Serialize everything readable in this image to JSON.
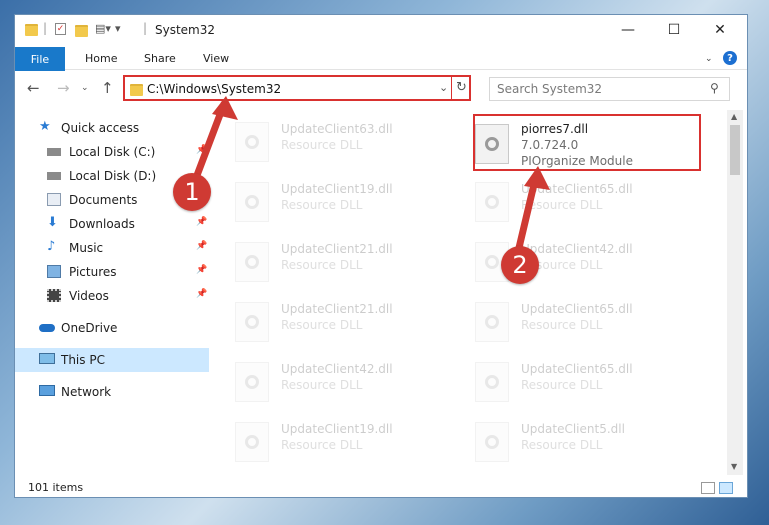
{
  "window": {
    "title": "System32",
    "controls": {
      "minimize": "—",
      "maximize": "☐",
      "close": "✕"
    }
  },
  "ribbon": {
    "file_tab": "File",
    "tabs": [
      "Home",
      "Share",
      "View"
    ],
    "help": "?"
  },
  "navigation": {
    "address": "C:\\Windows\\System32",
    "search_placeholder": "Search System32"
  },
  "sidebar": {
    "items": [
      {
        "label": "Quick access",
        "icon": "star-icon"
      },
      {
        "label": "Local Disk (C:)",
        "icon": "drive-icon",
        "pinned": true
      },
      {
        "label": "Local Disk (D:)",
        "icon": "drive-icon"
      },
      {
        "label": "Documents",
        "icon": "documents-icon",
        "pinned": true
      },
      {
        "label": "Downloads",
        "icon": "download-icon",
        "pinned": true
      },
      {
        "label": "Music",
        "icon": "music-icon",
        "pinned": true
      },
      {
        "label": "Pictures",
        "icon": "pictures-icon",
        "pinned": true
      },
      {
        "label": "Videos",
        "icon": "videos-icon",
        "pinned": true
      },
      {
        "label": "OneDrive",
        "icon": "cloud-icon"
      },
      {
        "label": "This PC",
        "icon": "computer-icon",
        "selected": true
      },
      {
        "label": "Network",
        "icon": "network-icon"
      }
    ]
  },
  "files": {
    "left_column": [
      {
        "name": "UpdateClient63.dll",
        "type": "Resource DLL"
      },
      {
        "name": "UpdateClient19.dll",
        "type": "Resource DLL"
      },
      {
        "name": "UpdateClient21.dll",
        "type": "Resource DLL"
      },
      {
        "name": "UpdateClient21.dll",
        "type": "Resource DLL"
      },
      {
        "name": "UpdateClient42.dll",
        "type": "Resource DLL"
      },
      {
        "name": "UpdateClient19.dll",
        "type": "Resource DLL"
      }
    ],
    "highlighted": {
      "name": "piorres7.dll",
      "version": "7.0.724.0",
      "description": "PIOrganize Module"
    },
    "right_column": [
      {
        "name": "UpdateClient65.dll",
        "type": "Resource DLL"
      },
      {
        "name": "UpdateClient42.dll",
        "type": "Resource DLL"
      },
      {
        "name": "UpdateClient65.dll",
        "type": "Resource DLL"
      },
      {
        "name": "UpdateClient65.dll",
        "type": "Resource DLL"
      },
      {
        "name": "UpdateClient5.dll",
        "type": "Resource DLL"
      }
    ]
  },
  "status": {
    "item_count": "101 items"
  },
  "callouts": {
    "step1": "1",
    "step2": "2"
  },
  "colors": {
    "highlight": "#d9312f",
    "badge": "#cf3a33",
    "file_tab": "#1979ca",
    "selected": "#cce8ff"
  }
}
